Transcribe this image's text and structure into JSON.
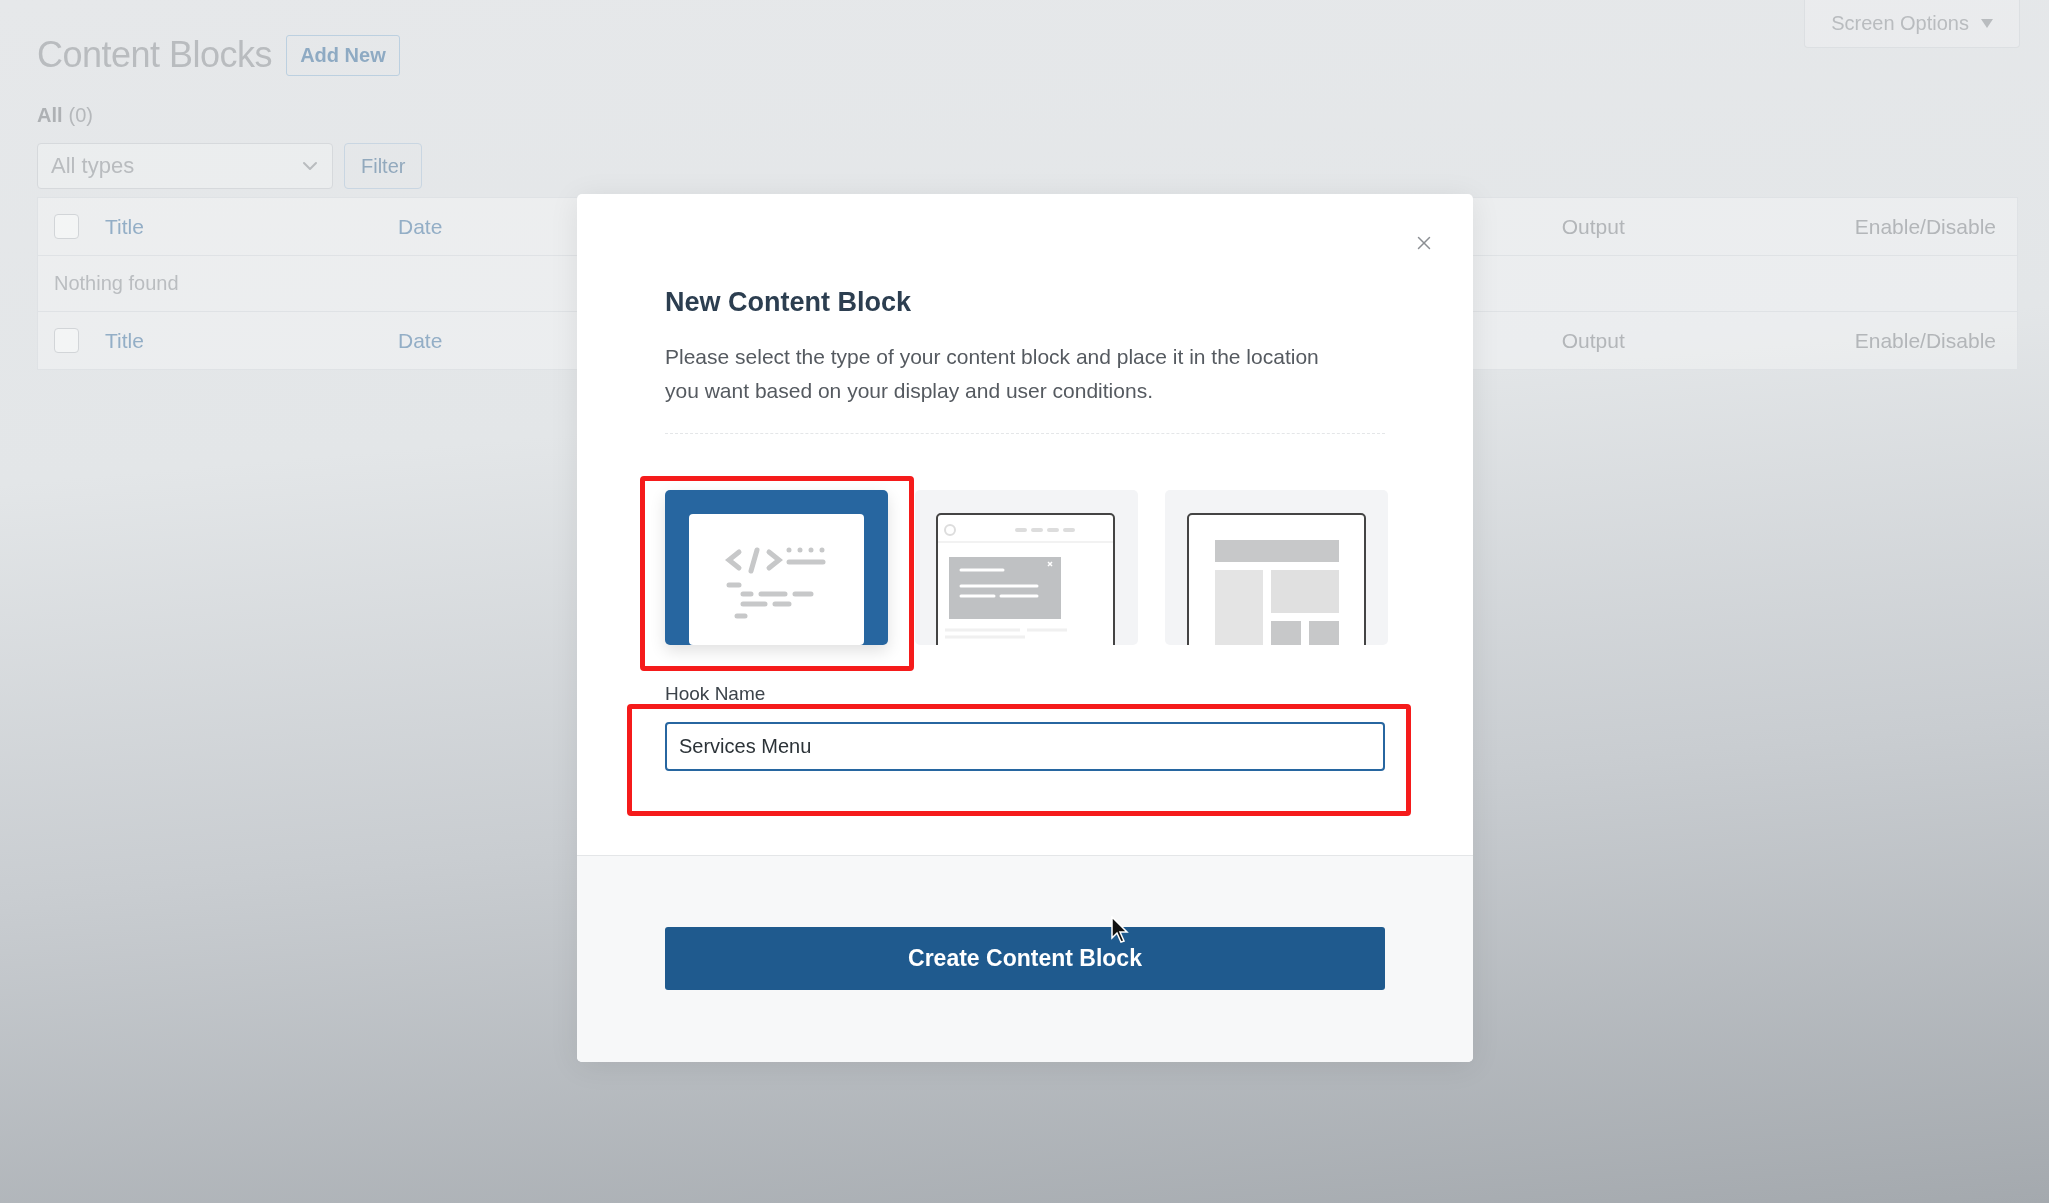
{
  "page": {
    "title": "Content Blocks",
    "add_new": "Add New",
    "screen_options": "Screen Options",
    "views": [
      {
        "label": "All",
        "count": "(0)",
        "selected": true
      }
    ],
    "type_filter": {
      "value": "All types"
    },
    "filter_button": "Filter",
    "table": {
      "header_checked": false,
      "footer_checked": false,
      "columns": [
        {
          "label": "Title",
          "sortable": true
        },
        {
          "label": "Date",
          "sortable": true
        },
        {
          "label": "Output",
          "sortable": false
        },
        {
          "label": "Enable/Disable",
          "sortable": false
        }
      ],
      "footer_columns": [
        {
          "label": "Title",
          "sortable": true
        },
        {
          "label": "Date",
          "sortable": true
        },
        {
          "label": "Output",
          "sortable": false
        },
        {
          "label": "Enable/Disable",
          "sortable": false
        }
      ],
      "empty": "Nothing found"
    }
  },
  "modal": {
    "title": "New Content Block",
    "description": "Please select the type of your content block and place it in the location you want based on your display and user conditions.",
    "types": [
      {
        "kind": "code",
        "selected": true,
        "highlighted": true
      },
      {
        "kind": "popup",
        "selected": false,
        "highlighted": false
      },
      {
        "kind": "layout",
        "selected": false,
        "highlighted": false
      }
    ],
    "hook_field": {
      "label": "Hook Name",
      "value": "Services Menu",
      "highlighted": true
    },
    "submit": "Create Content Block"
  }
}
